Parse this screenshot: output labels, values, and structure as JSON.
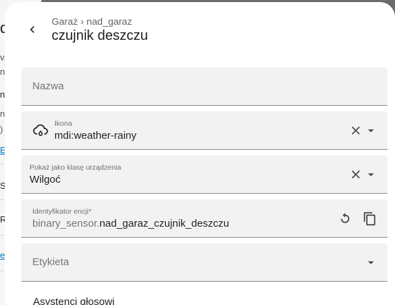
{
  "background": {
    "fragments": [
      "d",
      "v",
      "nt",
      "ny",
      "ne",
      ")",
      "E",
      "S",
      "R",
      "e"
    ]
  },
  "header": {
    "breadcrumb_parent": "Garaż",
    "breadcrumb_separator": "›",
    "breadcrumb_child": "nad_garaz",
    "title": "czujnik deszczu"
  },
  "fields": {
    "name": {
      "label": "Nazwa"
    },
    "icon": {
      "label": "Ikona",
      "value": "mdi:weather-rainy",
      "icon": "weather-rainy-icon"
    },
    "device_class": {
      "label": "Pokaż jako klasę urządzenia",
      "value": "Wilgoć"
    },
    "entity_id": {
      "label": "Identyfikator encji*",
      "prefix": "binary_sensor.",
      "value": "nad_garaz_czujnik_deszczu"
    },
    "tag": {
      "label": "Etykieta"
    }
  },
  "voice_assistants": {
    "label": "Asystenci głosowi"
  },
  "colors": {
    "field_bg": "#f2f2f2",
    "text": "#212121",
    "muted": "#757575",
    "link": "#0b7bbf"
  }
}
